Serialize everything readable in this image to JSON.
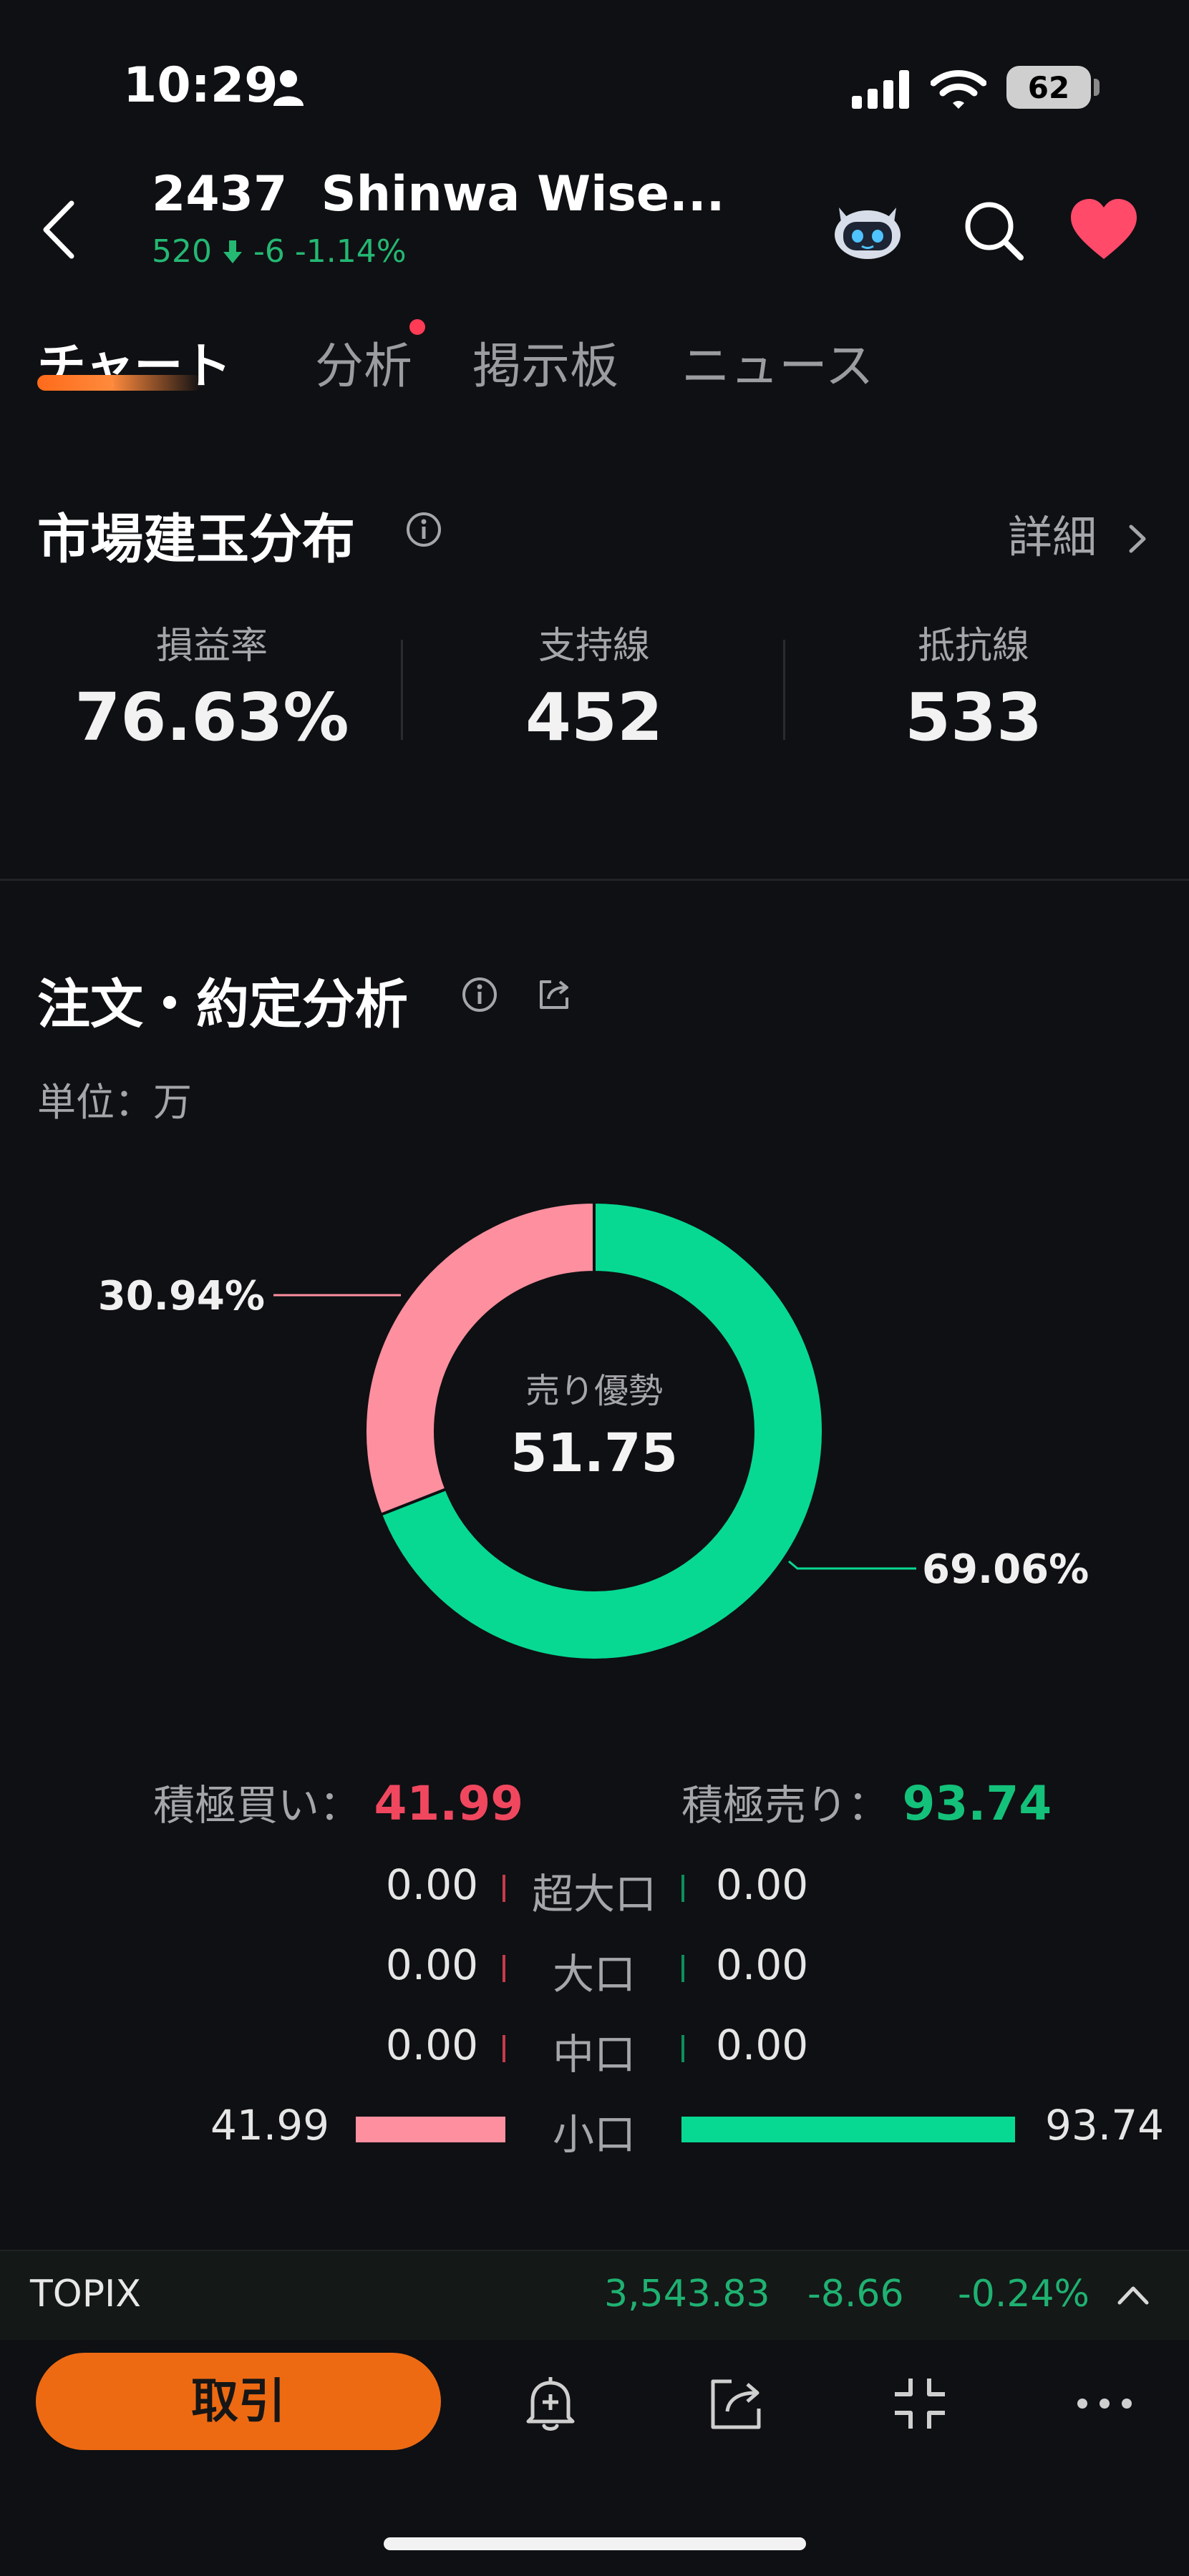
{
  "status_bar": {
    "time": "10:29",
    "battery": "62"
  },
  "header": {
    "code": "2437",
    "name": "Shinwa Wise...",
    "price": "520",
    "change": "-6",
    "change_pct": "-1.14%"
  },
  "tabs": [
    {
      "label": "チャート",
      "active": true
    },
    {
      "label": "分析",
      "has_dot": true
    },
    {
      "label": "掲示板"
    },
    {
      "label": "ニュース"
    }
  ],
  "position_distribution": {
    "title": "市場建玉分布",
    "detail_label": "詳細",
    "stats": [
      {
        "label": "損益率",
        "value": "76.63%"
      },
      {
        "label": "支持線",
        "value": "452"
      },
      {
        "label": "抵抗線",
        "value": "533"
      }
    ]
  },
  "order_analysis": {
    "title": "注文・約定分析",
    "unit": "単位：万",
    "donut": {
      "center_label": "売り優勢",
      "center_value": "51.75",
      "buy_pct_label": "30.94%",
      "sell_pct_label": "69.06%",
      "buy_fraction": 0.3094,
      "sell_fraction": 0.6906,
      "buy_color": "#fe8f9f",
      "sell_color": "#07d992"
    },
    "active_buy_label": "積極買い：",
    "active_buy_value": "41.99",
    "active_sell_label": "積極売り：",
    "active_sell_value": "93.74",
    "rows": [
      {
        "buy": "0.00",
        "label": "超大口",
        "sell": "0.00",
        "buy_bar": 0,
        "sell_bar": 0
      },
      {
        "buy": "0.00",
        "label": "大口",
        "sell": "0.00",
        "buy_bar": 0,
        "sell_bar": 0
      },
      {
        "buy": "0.00",
        "label": "中口",
        "sell": "0.00",
        "buy_bar": 0,
        "sell_bar": 0
      },
      {
        "buy": "41.99",
        "label": "小口",
        "sell": "93.74",
        "buy_bar": 41.99,
        "sell_bar": 93.74
      }
    ]
  },
  "ticker": {
    "name": "TOPIX",
    "value": "3,543.83",
    "change": "-8.66",
    "change_pct": "-0.24%"
  },
  "bottom_bar": {
    "trade_label": "取引",
    "icons": [
      "bell-plus-icon",
      "share-icon",
      "collapse-icon",
      "more-icon"
    ]
  }
}
